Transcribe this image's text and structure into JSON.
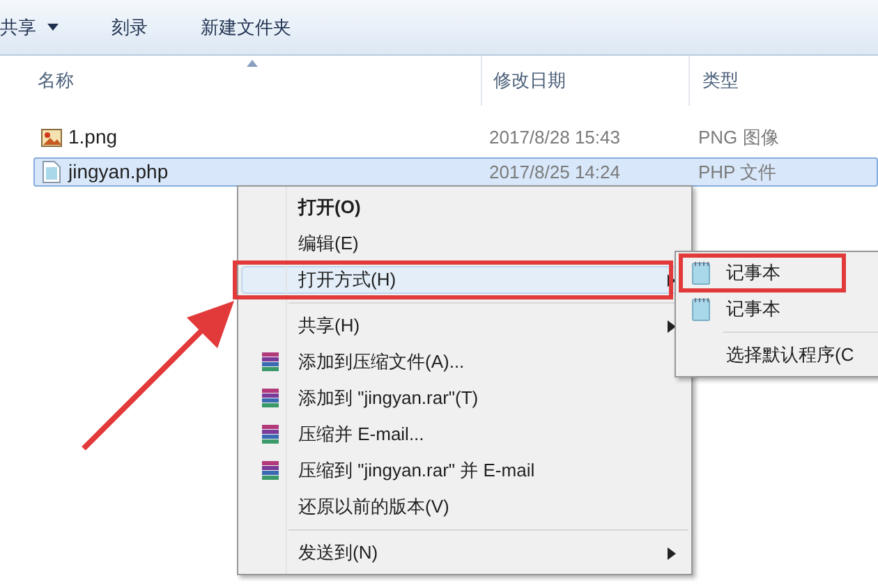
{
  "toolbar": {
    "items": [
      {
        "label": "共享",
        "dropdown": true
      },
      {
        "label": "刻录",
        "dropdown": false
      },
      {
        "label": "新建文件夹",
        "dropdown": false
      }
    ]
  },
  "table": {
    "columns": [
      "名称",
      "修改日期",
      "类型"
    ],
    "rows": [
      {
        "kind": "image",
        "name": "1.png",
        "date": "2017/8/28 15:43",
        "type": "PNG 图像",
        "selected": false
      },
      {
        "kind": "document",
        "name": "jingyan.php",
        "date": "2017/8/25 14:24",
        "type": "PHP 文件",
        "selected": true
      }
    ]
  },
  "context_menu": {
    "items": [
      {
        "kind": "item",
        "label": "打开(O)",
        "default": true,
        "selected": false,
        "submenu": false,
        "highlighted": false
      },
      {
        "kind": "item",
        "label": "编辑(E)",
        "default": false,
        "selected": false,
        "submenu": false,
        "highlighted": false
      },
      {
        "kind": "item",
        "label": "打开方式(H)",
        "default": false,
        "selected": true,
        "submenu": true,
        "highlighted": true
      },
      {
        "kind": "separator"
      },
      {
        "kind": "item",
        "label": "共享(H)",
        "default": false,
        "selected": false,
        "submenu": true,
        "highlighted": false
      },
      {
        "kind": "archive",
        "label": "添加到压缩文件(A)...",
        "default": false,
        "selected": false,
        "submenu": false,
        "highlighted": false
      },
      {
        "kind": "archive",
        "label": "添加到 \"jingyan.rar\"(T)",
        "default": false,
        "selected": false,
        "submenu": false,
        "highlighted": false
      },
      {
        "kind": "archive",
        "label": "压缩并 E-mail...",
        "default": false,
        "selected": false,
        "submenu": false,
        "highlighted": false
      },
      {
        "kind": "archive",
        "label": "压缩到 \"jingyan.rar\" 并 E-mail",
        "default": false,
        "selected": false,
        "submenu": false,
        "highlighted": false
      },
      {
        "kind": "item",
        "label": "还原以前的版本(V)",
        "default": false,
        "selected": false,
        "submenu": false,
        "highlighted": false
      },
      {
        "kind": "separator"
      },
      {
        "kind": "item",
        "label": "发送到(N)",
        "default": false,
        "selected": false,
        "submenu": true,
        "highlighted": false
      }
    ]
  },
  "submenu": {
    "items": [
      {
        "kind": "notepad",
        "label": "记事本",
        "highlighted": true
      },
      {
        "kind": "notepad",
        "label": "记事本",
        "highlighted": false
      },
      {
        "kind": "separator"
      },
      {
        "kind": "item",
        "label": "选择默认程序(C",
        "highlighted": false
      }
    ]
  }
}
